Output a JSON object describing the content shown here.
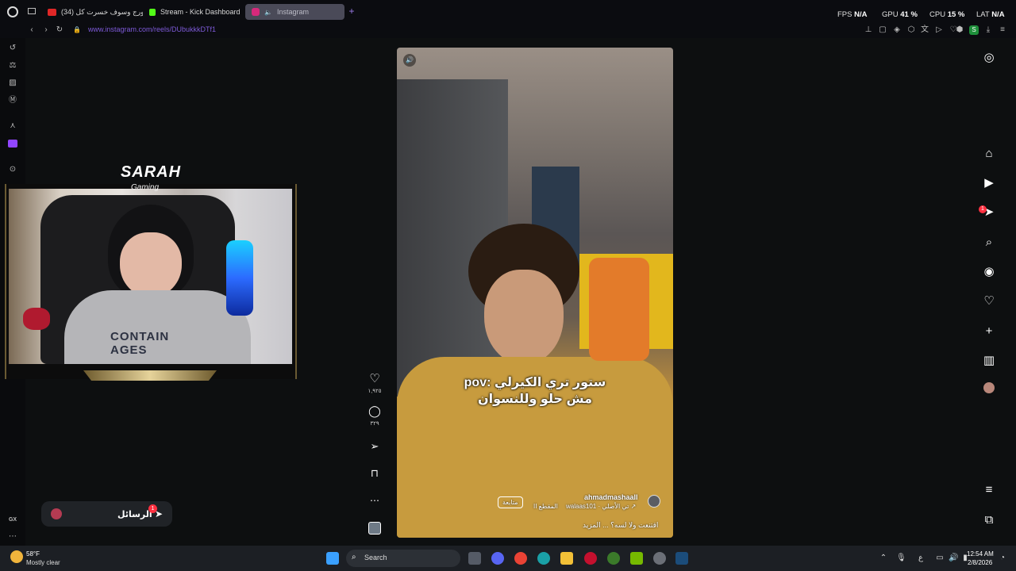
{
  "tabs": [
    {
      "label": "(34) جورج وسوف خسرت كل",
      "color": "#e02727"
    },
    {
      "label": "Stream - Kick Dashboard",
      "color": "#53fc18"
    },
    {
      "label": "Instagram",
      "color": "#d6297b"
    }
  ],
  "perf": {
    "fps_label": "FPS",
    "fps_value": "N/A",
    "gpu_label": "GPU",
    "gpu_value": "41 %",
    "cpu_label": "CPU",
    "cpu_value": "15 %",
    "lat_label": "LAT",
    "lat_value": "N/A"
  },
  "address": {
    "url": "www.instagram.com/reels/DUbukkkDTf1"
  },
  "overlay": {
    "logo": "SARAH",
    "logo_sub": "Gaming",
    "cam_shirt_text": "CONTAIN AGES"
  },
  "messages": {
    "label": "الرسائل",
    "badge": "1"
  },
  "reel": {
    "caption_line1": "pov: ستور تري الكيرلي",
    "caption_line2": "مش حلو وللنسوان",
    "username": "ahmadmashaall",
    "audio": "walaas101 · تي الأصلي ↗",
    "segment": "المقطع اا",
    "follow": "متابعة",
    "description": "اقتنعت ولا لسه؟ ... المزيد",
    "likes": "١,٩٢٥",
    "comments": "٣٢٩"
  },
  "rnav": {
    "notification_badge": "1"
  },
  "leftbar": {
    "gx_label": "GX"
  },
  "taskbar": {
    "temp": "58°F",
    "weather": "Mostly clear",
    "search": "Search",
    "time": "12:54 AM",
    "date": "2/8/2026",
    "lang": "ع"
  },
  "colors": {
    "accent": "#7d5ad8",
    "bg": "#0d0f10",
    "youtube": "#e02727",
    "kick": "#53fc18",
    "instagram": "#d6297b"
  }
}
